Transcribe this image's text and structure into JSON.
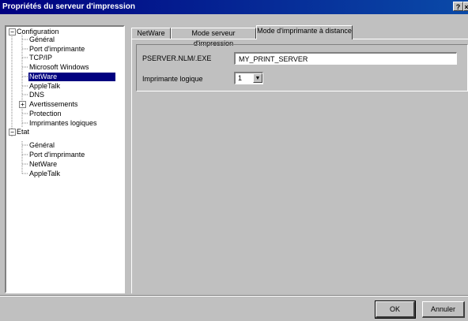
{
  "window": {
    "title": "Propriétés du serveur d'impression",
    "help_btn": "?",
    "close_btn": "×"
  },
  "tree": {
    "configuration": "Configuration",
    "config_items": [
      "Général",
      "Port d'imprimante",
      "TCP/IP",
      "Microsoft Windows",
      "NetWare",
      "AppleTalk",
      "DNS",
      "Avertissements",
      "Protection",
      "Imprimantes logiques"
    ],
    "etat": "Etat",
    "etat_items": [
      "Général",
      "Port d'imprimante",
      "NetWare",
      "AppleTalk"
    ],
    "selected": "NetWare"
  },
  "tabs": [
    "NetWare",
    "Mode serveur d'impression",
    "Mode d'imprimante à distance"
  ],
  "active_tab": "Mode d'imprimante à distance",
  "form": {
    "pserver_label": "PSERVER.NLM/.EXE",
    "pserver_value": "MY_PRINT_SERVER",
    "logical_printer_label": "Imprimante logique",
    "logical_printer_value": "1"
  },
  "buttons": {
    "ok": "OK",
    "cancel": "Annuler"
  },
  "colors": {
    "title_bar": "#000080",
    "face": "#c0c0c0",
    "selection": "#000080"
  }
}
